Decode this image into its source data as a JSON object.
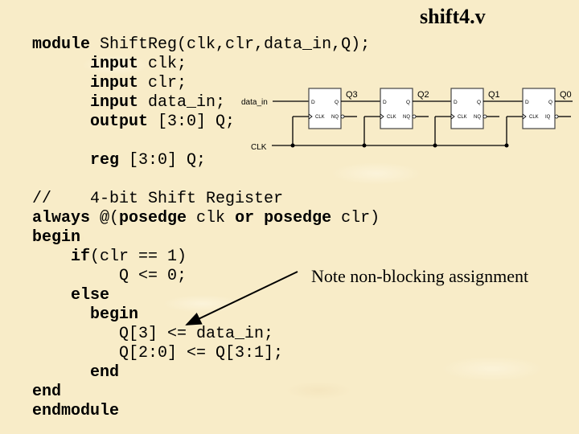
{
  "title": "shift4.v",
  "code_lines": [
    [
      {
        "t": "module",
        "kw": true
      },
      {
        "t": " ShiftReg(clk,clr,data_in,Q);",
        "kw": false
      }
    ],
    [
      {
        "t": "      ",
        "kw": false
      },
      {
        "t": "input",
        "kw": true
      },
      {
        "t": " clk;",
        "kw": false
      }
    ],
    [
      {
        "t": "      ",
        "kw": false
      },
      {
        "t": "input",
        "kw": true
      },
      {
        "t": " clr;",
        "kw": false
      }
    ],
    [
      {
        "t": "      ",
        "kw": false
      },
      {
        "t": "input",
        "kw": true
      },
      {
        "t": " data_in;",
        "kw": false
      }
    ],
    [
      {
        "t": "      ",
        "kw": false
      },
      {
        "t": "output",
        "kw": true
      },
      {
        "t": " [3:0] Q;",
        "kw": false
      }
    ],
    [
      {
        "t": "",
        "kw": false
      }
    ],
    [
      {
        "t": "      ",
        "kw": false
      },
      {
        "t": "reg",
        "kw": true
      },
      {
        "t": " [3:0] Q;",
        "kw": false
      }
    ],
    [
      {
        "t": "",
        "kw": false
      }
    ],
    [
      {
        "t": "//    4-bit Shift Register",
        "kw": false
      }
    ],
    [
      {
        "t": "always",
        "kw": true
      },
      {
        "t": " @(",
        "kw": false
      },
      {
        "t": "posedge",
        "kw": true
      },
      {
        "t": " clk ",
        "kw": false
      },
      {
        "t": "or",
        "kw": true
      },
      {
        "t": " ",
        "kw": false
      },
      {
        "t": "posedge",
        "kw": true
      },
      {
        "t": " clr)",
        "kw": false
      }
    ],
    [
      {
        "t": "begin",
        "kw": true
      }
    ],
    [
      {
        "t": "    ",
        "kw": false
      },
      {
        "t": "if",
        "kw": true
      },
      {
        "t": "(clr == 1)",
        "kw": false
      }
    ],
    [
      {
        "t": "         Q <= 0;",
        "kw": false
      }
    ],
    [
      {
        "t": "    ",
        "kw": false
      },
      {
        "t": "else",
        "kw": true
      }
    ],
    [
      {
        "t": "      ",
        "kw": false
      },
      {
        "t": "begin",
        "kw": true
      }
    ],
    [
      {
        "t": "         Q[3] <= data_in;",
        "kw": false
      }
    ],
    [
      {
        "t": "         Q[2:0] <= Q[3:1];",
        "kw": false
      }
    ],
    [
      {
        "t": "      ",
        "kw": false
      },
      {
        "t": "end",
        "kw": true
      }
    ],
    [
      {
        "t": "end",
        "kw": true
      }
    ],
    [
      {
        "t": "endmodule",
        "kw": true
      }
    ]
  ],
  "note": "Note non-blocking assignment",
  "diagram": {
    "input_label": "data_in",
    "clock_label": "CLK",
    "flip_flops": [
      {
        "output": "Q3",
        "d": "D",
        "q": "Q",
        "clk": "CLK",
        "nq": "NQ"
      },
      {
        "output": "Q2",
        "d": "D",
        "q": "Q",
        "clk": "CLK",
        "nq": "NQ"
      },
      {
        "output": "Q1",
        "d": "D",
        "q": "Q",
        "clk": "CLK",
        "nq": "NQ"
      },
      {
        "output": "Q0",
        "d": "D",
        "q": "Q",
        "clk": "CLK",
        "nq": "IQ"
      }
    ]
  }
}
